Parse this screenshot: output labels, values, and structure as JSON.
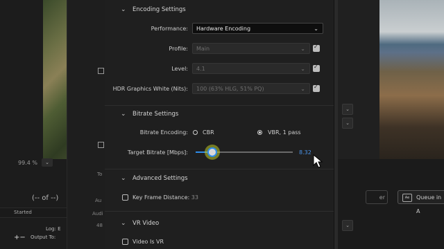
{
  "background": {
    "zoom_level": "99.4",
    "zoom_unit": "%",
    "queue_count": "(-- of --)",
    "started_header": "Started",
    "log_label": "Log:",
    "log_value": "E",
    "output_label": "Output To:",
    "plus": "+",
    "minus": "−",
    "queue_button": "Queue in A",
    "queue_icon_text": "Ae",
    "other_button": "er",
    "top_label": "To",
    "au_label": "Au",
    "audi_label": "Audi",
    "num_48": "48"
  },
  "encoding": {
    "section_title": "Encoding Settings",
    "performance_label": "Performance:",
    "performance_value": "Hardware Encoding",
    "profile_label": "Profile:",
    "profile_value": "Main",
    "level_label": "Level:",
    "level_value": "4.1",
    "hdr_label": "HDR Graphics White (Nits):",
    "hdr_value": "100 (63% HLG, 51% PQ)"
  },
  "bitrate": {
    "section_title": "Bitrate Settings",
    "encoding_label": "Bitrate Encoding:",
    "option_cbr": "CBR",
    "option_vbr": "VBR, 1 pass",
    "selected": "VBR, 1 pass",
    "target_label": "Target Bitrate [Mbps]:",
    "target_value": "8.32",
    "slider_fraction": 0.17
  },
  "advanced": {
    "section_title": "Advanced Settings",
    "keyframe_label": "Key Frame Distance:",
    "keyframe_value": "33"
  },
  "vr": {
    "section_title": "VR Video",
    "video_is_vr_label": "Video Is VR"
  },
  "colors": {
    "accent": "#2d8ceb",
    "panel_bg": "#1f1f1f"
  },
  "icons": {
    "chevron": "chevron-down-icon",
    "cursor": "mouse-pointer-icon"
  }
}
